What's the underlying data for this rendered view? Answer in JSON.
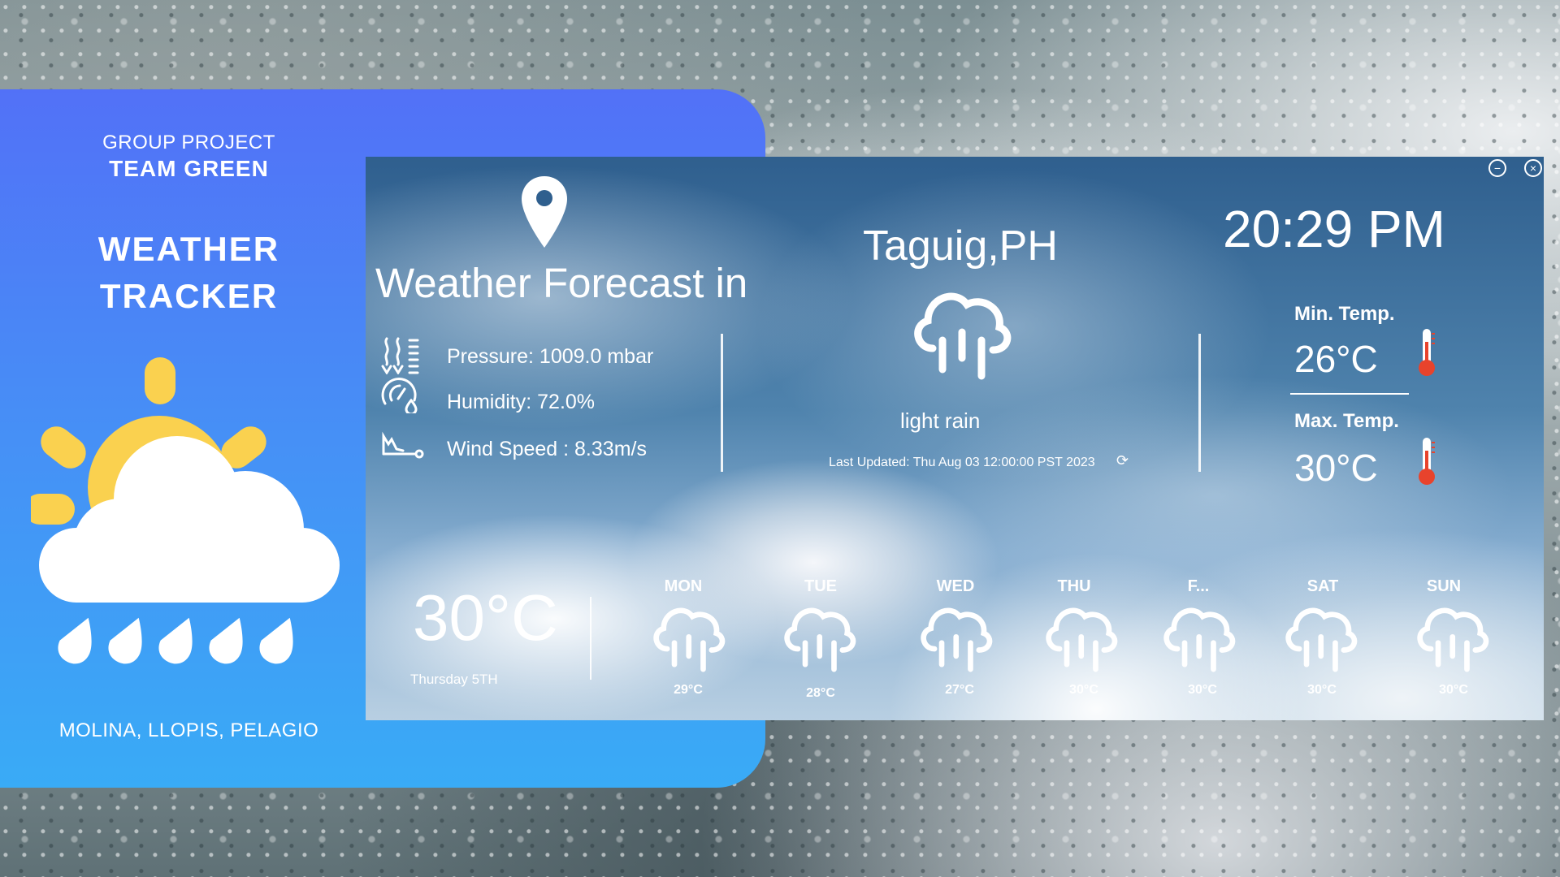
{
  "presentation": {
    "group_label": "GROUP PROJECT",
    "team_label": "TEAM GREEN",
    "title_line1": "WEATHER",
    "title_line2": "TRACKER",
    "authors": "MOLINA, LLOPIS, PELAGIO",
    "illustration_icon": "sun-cloud-rain-icon",
    "colors": {
      "card_top": "#5271f7",
      "card_bottom": "#39abf6",
      "sun": "#fad14f"
    }
  },
  "window": {
    "controls": {
      "minimize_icon": "minimize-icon",
      "close_icon": "close-icon"
    }
  },
  "weather": {
    "location_icon": "location-pin-icon",
    "heading": "Weather Forecast in",
    "city": "Taguig,PH",
    "time": "20:29 PM",
    "condition": "light rain",
    "condition_icon": "rain-cloud-icon",
    "last_updated": "Last Updated: Thu Aug 03 12:00:00 PST 2023",
    "refresh_icon": "refresh-icon",
    "metrics": {
      "pressure": "Pressure: 1009.0 mbar",
      "humidity": "Humidity: 72.0%",
      "wind": "Wind Speed : 8.33m/s"
    },
    "min_temp_label": "Min. Temp.",
    "min_temp": "26°C",
    "max_temp_label": "Max. Temp.",
    "max_temp": "30°C",
    "current_temp": "30°C",
    "current_date": "Thursday 5TH"
  },
  "forecast": [
    {
      "day": "MON",
      "temp": "29°C",
      "icon": "rain-cloud-icon"
    },
    {
      "day": "TUE",
      "temp": "28°C",
      "icon": "rain-cloud-icon"
    },
    {
      "day": "WED",
      "temp": "27°C",
      "icon": "rain-cloud-icon"
    },
    {
      "day": "THU",
      "temp": "30°C",
      "icon": "rain-cloud-icon"
    },
    {
      "day": "F...",
      "temp": "30°C",
      "icon": "rain-cloud-icon"
    },
    {
      "day": "SAT",
      "temp": "30°C",
      "icon": "rain-cloud-icon"
    },
    {
      "day": "SUN",
      "temp": "30°C",
      "icon": "rain-cloud-icon"
    }
  ]
}
